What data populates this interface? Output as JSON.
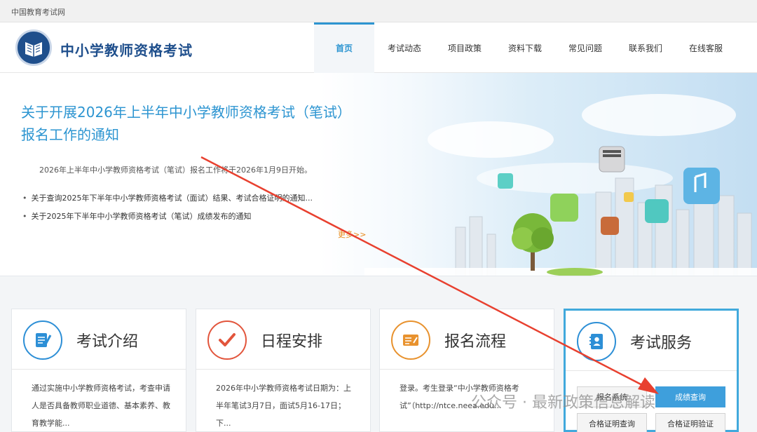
{
  "topbar": {
    "text": "中国教育考试网"
  },
  "header": {
    "site_title": "中小学教师资格考试",
    "nav": [
      "首页",
      "考试动态",
      "项目政策",
      "资料下载",
      "常见问题",
      "联系我们",
      "在线客服"
    ]
  },
  "hero": {
    "title": "关于开展2026年上半年中小学教师资格考试（笔试）报名工作的通知",
    "summary": "2026年上半年中小学教师资格考试（笔试）报名工作将于2026年1月9日开始。",
    "news": [
      "关于查询2025年下半年中小学教师资格考试（面试）结果、考试合格证明的通知...",
      "关于2025年下半年中小学教师资格考试（笔试）成绩发布的通知"
    ],
    "more": "更多>>"
  },
  "cards": [
    {
      "title": "考试介绍",
      "icon": "document-icon",
      "body": "通过实施中小学教师资格考试，考查申请人是否具备教师职业道德、基本素养、教育教学能..."
    },
    {
      "title": "日程安排",
      "icon": "checkmark-icon",
      "body": "2026年中小学教师资格考试日期为：上半年笔试3月7日，面试5月16-17日；下..."
    },
    {
      "title": "报名流程",
      "icon": "form-icon",
      "body": "登录。考生登录“中小学教师资格考试”（http://ntce.neea.edu..."
    },
    {
      "title": "考试服务",
      "icon": "contacts-icon",
      "buttons": [
        "报名系统",
        "成绩查询",
        "合格证明查询",
        "合格证明验证"
      ]
    }
  ],
  "watermark": "公众号 · 最新政策信息解读",
  "colors": {
    "brand": "#1f4f8c",
    "accent": "#2d95d1",
    "arrow": "#e8402f",
    "more": "#e88a1a"
  }
}
